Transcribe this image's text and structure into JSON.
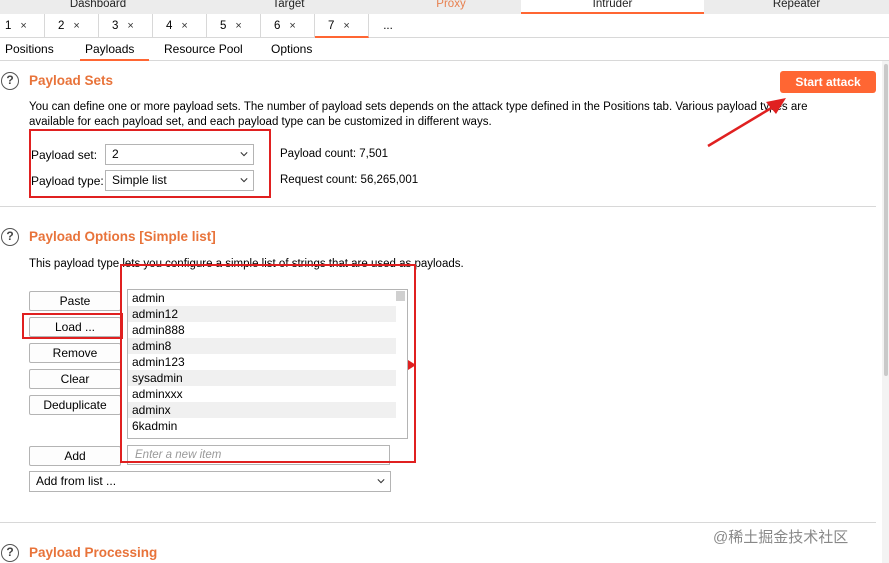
{
  "tool_tabs": [
    {
      "label": "Dashboard"
    },
    {
      "label": "Target"
    },
    {
      "label": "Proxy"
    },
    {
      "label": "Intruder"
    },
    {
      "label": "Repeater"
    }
  ],
  "attack_tabs": [
    {
      "label": "1",
      "close": "×"
    },
    {
      "label": "2",
      "close": "×"
    },
    {
      "label": "3",
      "close": "×"
    },
    {
      "label": "4",
      "close": "×"
    },
    {
      "label": "5",
      "close": "×"
    },
    {
      "label": "6",
      "close": "×"
    },
    {
      "label": "7",
      "close": "×"
    },
    {
      "label": "..."
    }
  ],
  "sub_tabs": [
    {
      "label": "Positions"
    },
    {
      "label": "Payloads"
    },
    {
      "label": "Resource Pool"
    },
    {
      "label": "Options"
    }
  ],
  "payload_sets": {
    "help": "?",
    "title": "Payload Sets",
    "start_attack": "Start attack",
    "desc_line1": "You can define one or more payload sets. The number of payload sets depends on the attack type defined in the Positions tab. Various payload types are",
    "desc_line2": "available for each payload set, and each payload type can be customized in different ways.",
    "set_label": "Payload set:",
    "set_value": "2",
    "type_label": "Payload type:",
    "type_value": "Simple list",
    "payload_count": "Payload count: 7,501",
    "request_count": "Request count: 56,265,001"
  },
  "payload_options": {
    "help": "?",
    "title": "Payload Options [Simple list]",
    "desc": "This payload type lets you configure a simple list of strings that are used as payloads.",
    "buttons": {
      "paste": "Paste",
      "load": "Load ...",
      "remove": "Remove",
      "clear": "Clear",
      "deduplicate": "Deduplicate",
      "add": "Add"
    },
    "items": [
      "admin",
      "admin12",
      "admin888",
      "admin8",
      "admin123",
      "sysadmin",
      "adminxxx",
      "adminx",
      "6kadmin"
    ],
    "new_item_placeholder": "Enter a new item",
    "add_from_list": "Add from list ..."
  },
  "payload_processing": {
    "help": "?",
    "title": "Payload Processing"
  },
  "watermark": "@稀土掘金技术社区",
  "colors": {
    "accent": "#ff6633",
    "section_title": "#e8733a",
    "annotation_red": "#e02020"
  }
}
